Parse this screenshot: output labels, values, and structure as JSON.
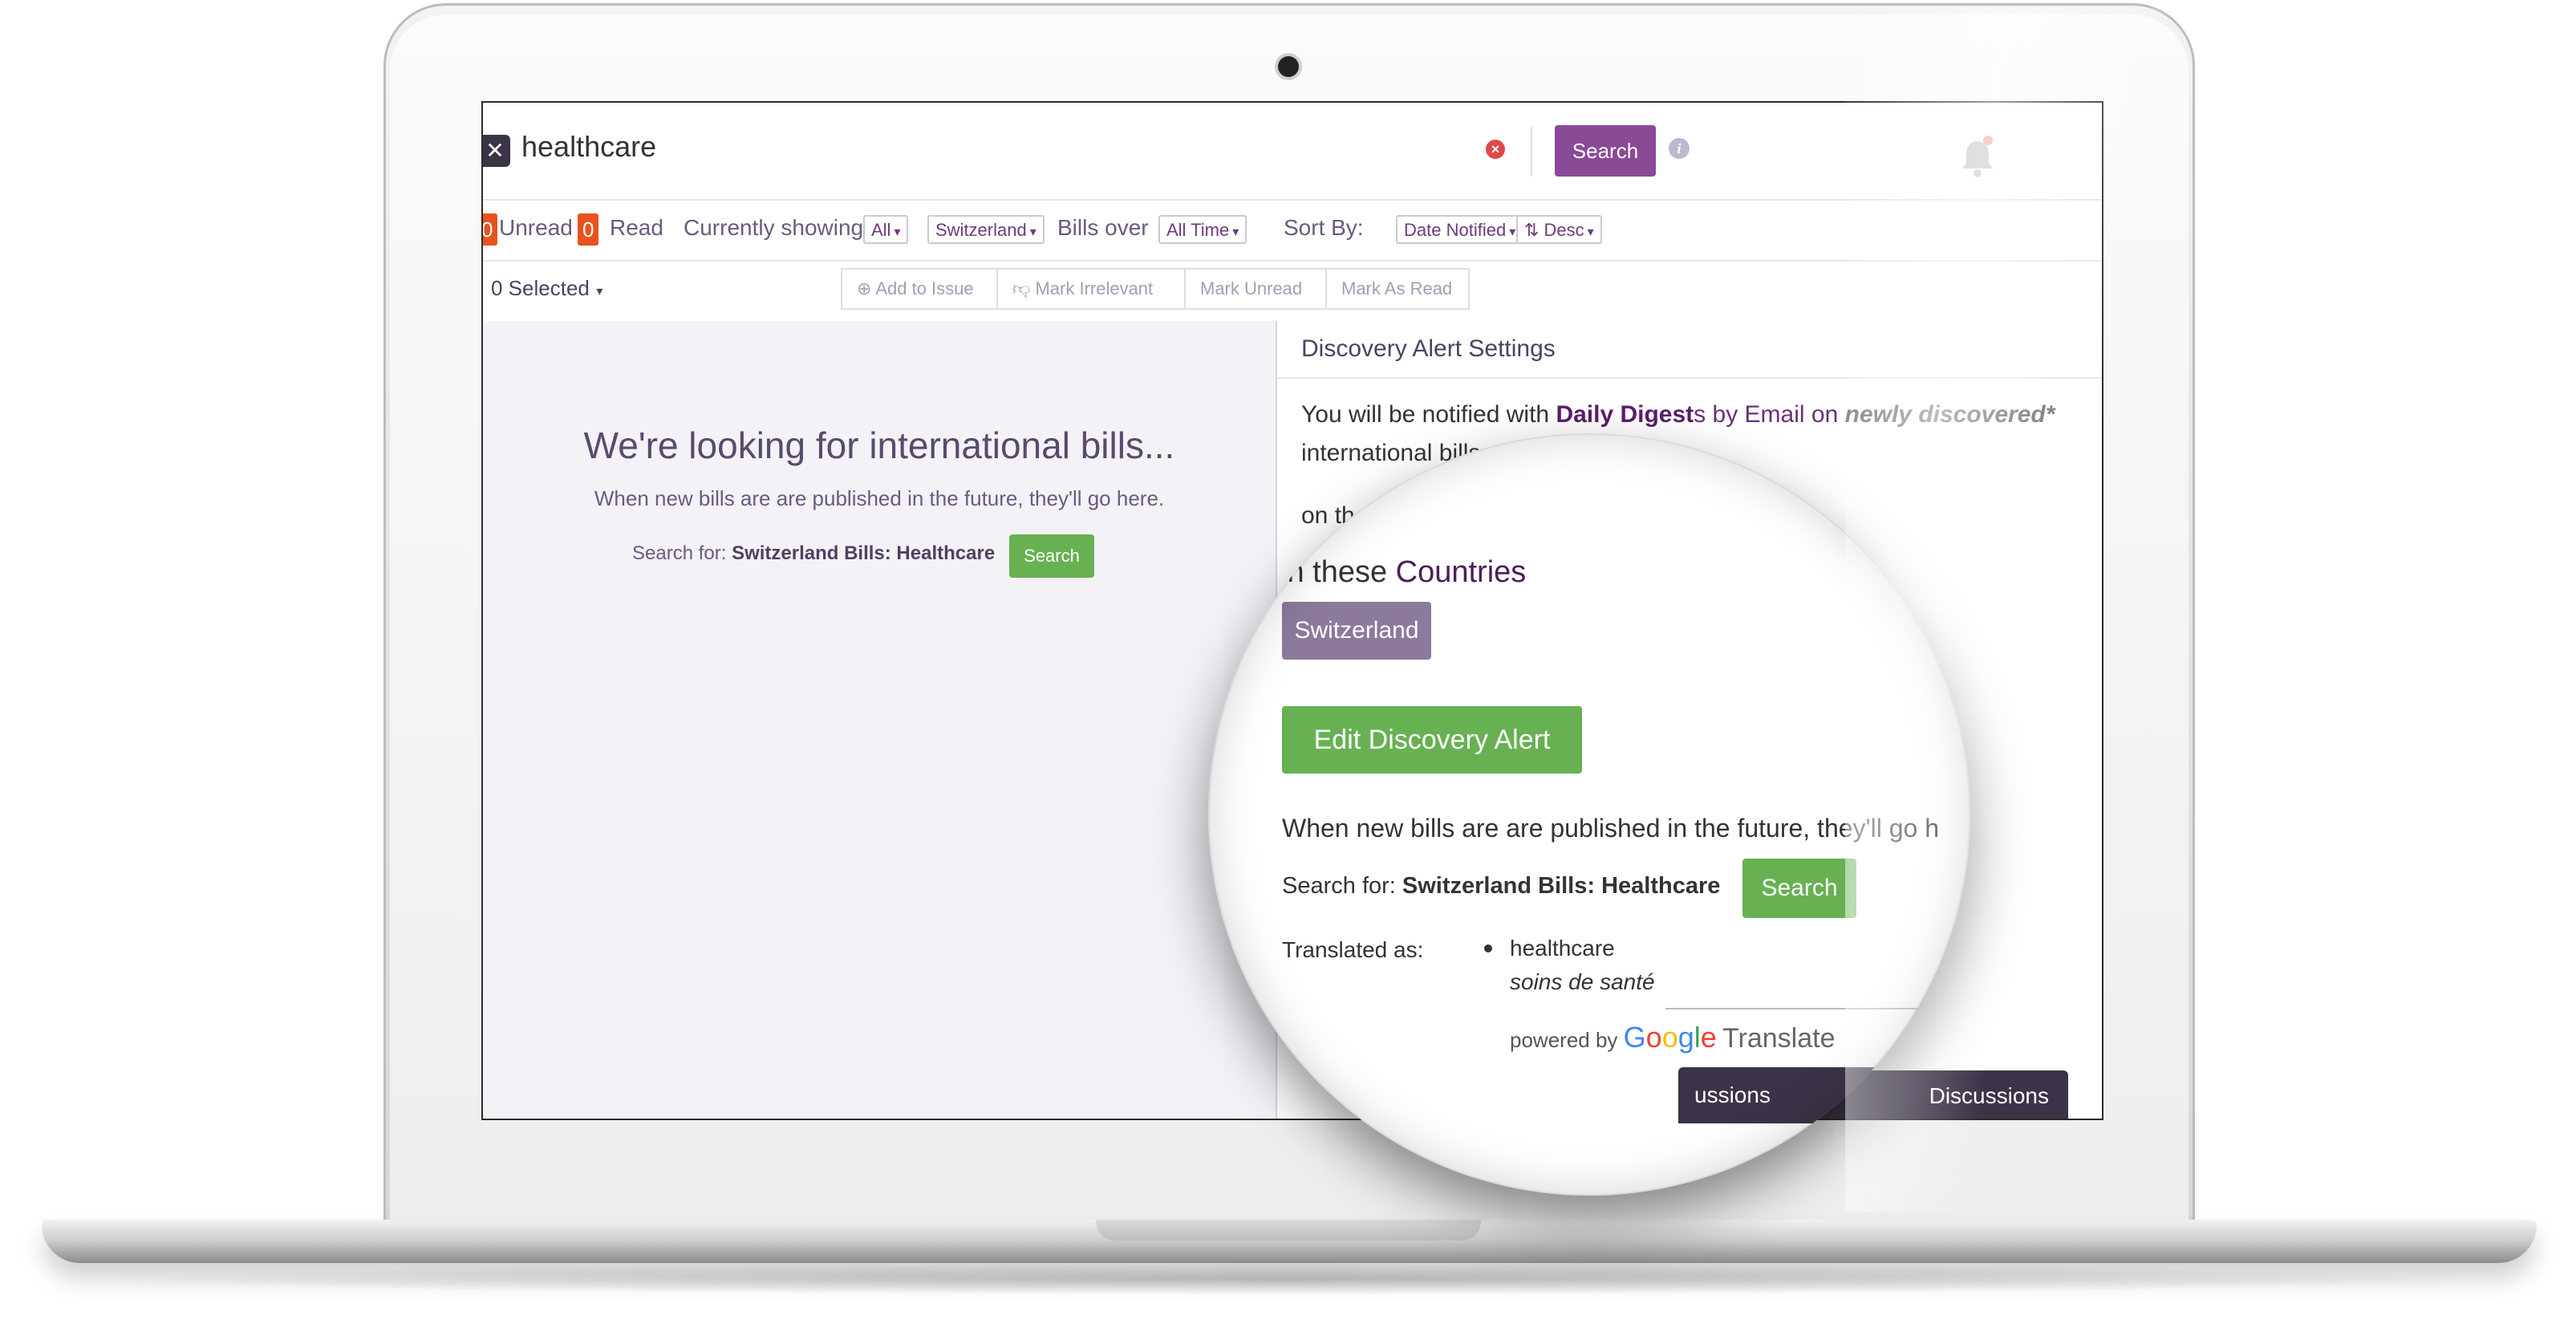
{
  "search": {
    "clear_symbol": "✕",
    "query": "healthcare",
    "clear_circle_symbol": "×",
    "button_label": "Search",
    "info_symbol": "i"
  },
  "filters": {
    "unread_count": "0",
    "unread_label": "Unread",
    "read_count": "0",
    "read_label": "Read",
    "showing_label": "Currently showing",
    "show_value": "All",
    "country_value": "Switzerland",
    "bills_over_label": "Bills over",
    "time_value": "All Time",
    "sort_by_label": "Sort By:",
    "sort_value": "Date Notified",
    "order_value": "Desc"
  },
  "actions": {
    "selected_label": "0 Selected",
    "add_to_issue": "Add to Issue",
    "mark_irrelevant": "Mark Irrelevant",
    "mark_unread": "Mark Unread",
    "mark_as_read": "Mark As Read"
  },
  "empty_state": {
    "title": "We're looking for international bills...",
    "subtitle": "When new bills are are published in the future, they'll go here.",
    "search_for_label": "Search for:",
    "search_for_value": "Switzerland Bills: Healthcare",
    "search_button": "Search"
  },
  "alert_panel": {
    "title": "Discovery Alert Settings",
    "notified_prefix": "You will be notified with",
    "digest": "Daily Digest",
    "digest_suffix": "s",
    "by": "by",
    "email": "Email",
    "on": "on",
    "newly_discovered": "newly discovered*",
    "international": "international bills",
    "on_the": "on the",
    "in_these": "in these",
    "countries": "Countries",
    "country_chip": "Switzerland",
    "edit_button": "Edit Discovery Alert",
    "published_text": "When new bills are are published in the future, they'll go h",
    "search_for_label": "Search for:",
    "search_for_value": "Switzerland Bills: Healthcare",
    "search_button": "Search",
    "translated_label": "Translated as:",
    "term": "healthcare",
    "term_translation": "soins de santé",
    "powered_by": "powered by",
    "translate_word": "Translate",
    "footer_button": "Discussions",
    "footer_button_visible": "ussions"
  },
  "colors": {
    "brand_purple": "#8a4a96",
    "green": "#67b153",
    "badge_orange": "#e8521f",
    "dark": "#3b3347"
  }
}
